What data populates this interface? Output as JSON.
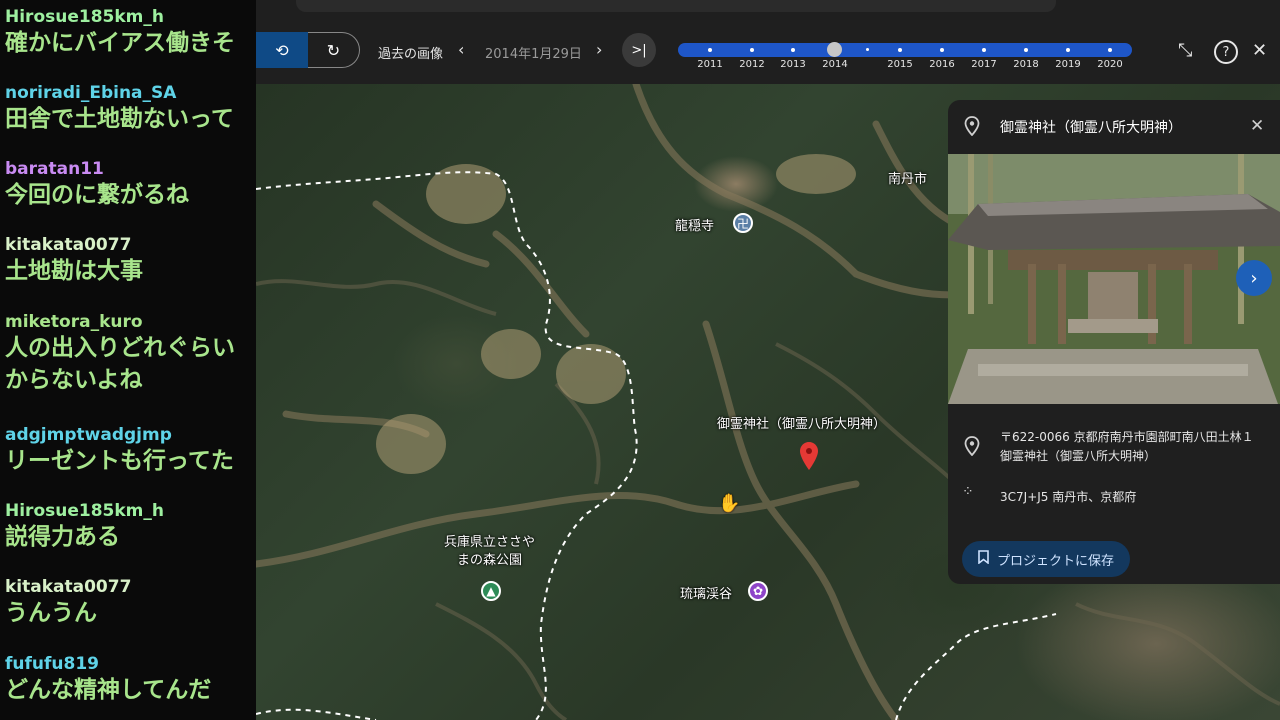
{
  "chat": {
    "messages": [
      {
        "user": "Hirosue185km_h",
        "user_color": "#9ef0a0",
        "text": "確かにバイアス働きそ"
      },
      {
        "user": "noriradi_Ebina_SA",
        "user_color": "#5fd3e8",
        "text": "田舎で土地勘ないって"
      },
      {
        "user": "baratan11",
        "user_color": "#c98bf2",
        "text": "今回のに繋がるね"
      },
      {
        "user": "kitakata0077",
        "user_color": "#d8f0c8",
        "text": "土地勘は大事"
      },
      {
        "user": "miketora_kuro",
        "user_color": "#a8e58c",
        "text": "人の出入りどれぐらい",
        "text2": "からないよね"
      },
      {
        "user": "adgjmptwadgjmp",
        "user_color": "#5fd3e8",
        "text": "リーゼントも行ってた"
      },
      {
        "user": "Hirosue185km_h",
        "user_color": "#9ef0a0",
        "text": "説得力ある"
      },
      {
        "user": "kitakata0077",
        "user_color": "#d8f0c8",
        "text": "うんうん"
      },
      {
        "user": "fufufu819",
        "user_color": "#5fd3e8",
        "text": "どんな精神してんだ"
      }
    ]
  },
  "toolbar": {
    "past_imagery_label": "過去の画像",
    "date": "2014年1月29日",
    "years": [
      "2011",
      "2012",
      "2013",
      "2014",
      "2015",
      "2016",
      "2017",
      "2018",
      "2019",
      "2020"
    ],
    "selected_year": "2014",
    "accent": "#1e56c8"
  },
  "map": {
    "labels": {
      "city": "南丹市",
      "temple": "龍穏寺",
      "shrine": "御霊神社（御霊八所大明神）",
      "park_line1": "兵庫県立ささや",
      "park_line2": "まの森公園",
      "valley": "琉璃渓谷"
    },
    "pin_color": "#e53935"
  },
  "card": {
    "title": "御霊神社（御霊八所大明神）",
    "address": "〒622-0066 京都府南丹市園部町南八田土林１ 御霊神社（御霊八所大明神）",
    "plus_code": "3C7J+J5 南丹市、京都府",
    "save_label": "プロジェクトに保存"
  }
}
